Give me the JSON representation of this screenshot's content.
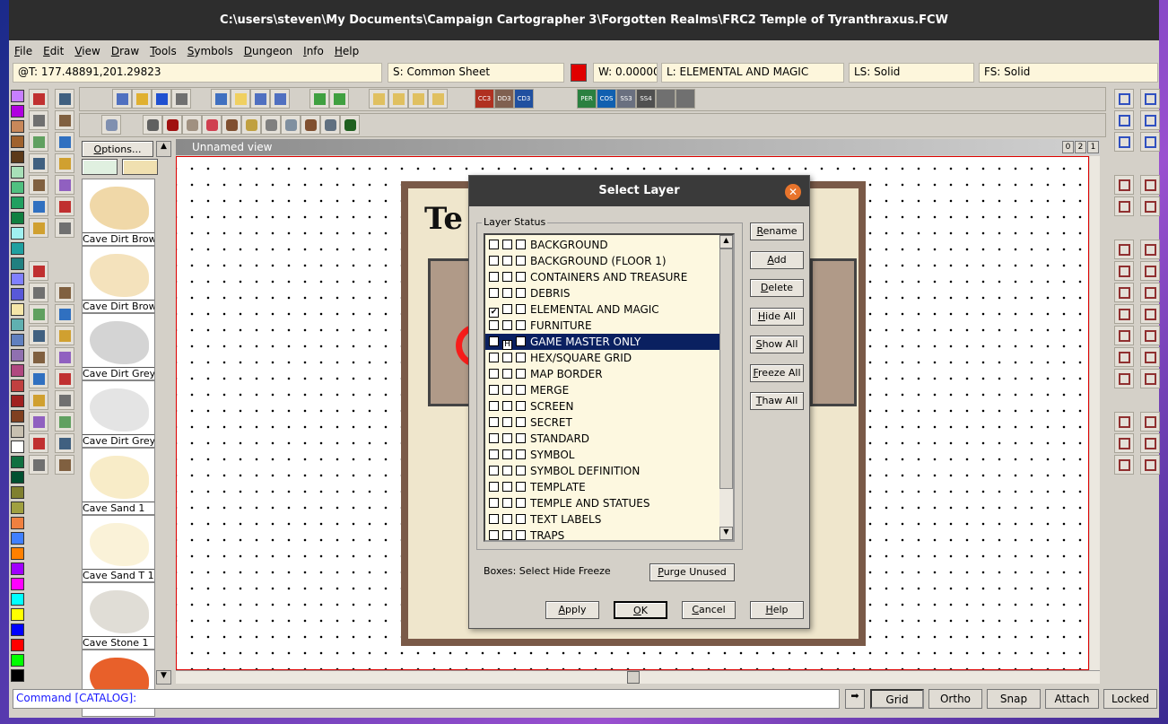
{
  "window": {
    "title": "C:\\users\\steven\\My Documents\\Campaign Cartographer 3\\Forgotten Realms\\FRC2 Temple of Tyranthraxus.FCW"
  },
  "menu": [
    "File",
    "Edit",
    "View",
    "Draw",
    "Tools",
    "Symbols",
    "Dungeon",
    "Info",
    "Help"
  ],
  "status": {
    "coords": "@T: 177.48891,201.29823",
    "sheet": "S: Common Sheet",
    "color": "#e00000",
    "width": "W: 0.00000",
    "layer": "L: ELEMENTAL AND MAGIC",
    "line_style": "LS: Solid",
    "fill_style": "FS: Solid"
  },
  "palette": [
    "#c77fff",
    "#b000e0",
    "#c8885a",
    "#a0622d",
    "#5c3a1a",
    "#a8e0b8",
    "#50c080",
    "#20a060",
    "#108040",
    "#a0f0f0",
    "#20a0a0",
    "#208080",
    "#8080ff",
    "#5858d8",
    "#f6e6a8",
    "#60b0b0",
    "#6080c0",
    "#9070b0",
    "#b04880",
    "#c04040",
    "#a02020",
    "#804020",
    "#c8c0b0",
    "#ffffff",
    "#107040",
    "#005030",
    "#808030",
    "#a0a040",
    "#f08040",
    "#4080ff",
    "#ff8000",
    "#a000ff",
    "#ff00ff",
    "#00ffff",
    "#ffff00",
    "#0000ff",
    "#ff0000",
    "#00ff00",
    "#000000"
  ],
  "toolbar_labels": [
    "CC3",
    "DD3",
    "CD3",
    "PER",
    "COS",
    "SS3",
    "SS4"
  ],
  "catalog": {
    "options_label": "Options...",
    "items": [
      {
        "label": "Cave Dirt Brow",
        "color": "#f0d8a8"
      },
      {
        "label": "Cave Dirt Brow",
        "color": "#f4e2bc"
      },
      {
        "label": "Cave Dirt Grey",
        "color": "#d4d4d4"
      },
      {
        "label": "Cave Dirt Grey",
        "color": "#e4e4e4"
      },
      {
        "label": "Cave Sand 1",
        "color": "#f8ecc8"
      },
      {
        "label": "Cave Sand T 1",
        "color": "#faf2d8"
      },
      {
        "label": "Cave Stone 1",
        "color": "#e0ddd6"
      },
      {
        "label": "",
        "color": "#e8602a"
      }
    ]
  },
  "view": {
    "title": "Unnamed view",
    "buttons": [
      "0",
      "2",
      "1"
    ],
    "map_title": "Te"
  },
  "dialog": {
    "title": "Select Layer",
    "group_label": "Layer Status",
    "layers": [
      {
        "name": "BACKGROUND",
        "s": "",
        "h": "",
        "f": ""
      },
      {
        "name": "BACKGROUND (FLOOR 1)",
        "s": "",
        "h": "",
        "f": ""
      },
      {
        "name": "CONTAINERS AND TREASURE",
        "s": "",
        "h": "",
        "f": ""
      },
      {
        "name": "DEBRIS",
        "s": "",
        "h": "",
        "f": ""
      },
      {
        "name": "ELEMENTAL AND MAGIC",
        "s": "✔",
        "h": "",
        "f": ""
      },
      {
        "name": "FURNITURE",
        "s": "",
        "h": "",
        "f": ""
      },
      {
        "name": "GAME MASTER ONLY",
        "s": "",
        "h": "H",
        "f": "",
        "selected": true
      },
      {
        "name": "HEX/SQUARE GRID",
        "s": "",
        "h": "",
        "f": ""
      },
      {
        "name": "MAP BORDER",
        "s": "",
        "h": "",
        "f": ""
      },
      {
        "name": "MERGE",
        "s": "",
        "h": "",
        "f": ""
      },
      {
        "name": "SCREEN",
        "s": "",
        "h": "",
        "f": ""
      },
      {
        "name": "SECRET",
        "s": "",
        "h": "",
        "f": ""
      },
      {
        "name": "STANDARD",
        "s": "",
        "h": "",
        "f": ""
      },
      {
        "name": "SYMBOL",
        "s": "",
        "h": "",
        "f": ""
      },
      {
        "name": "SYMBOL DEFINITION",
        "s": "",
        "h": "",
        "f": ""
      },
      {
        "name": "TEMPLATE",
        "s": "",
        "h": "",
        "f": ""
      },
      {
        "name": "TEMPLE AND STATUES",
        "s": "",
        "h": "",
        "f": ""
      },
      {
        "name": "TEXT LABELS",
        "s": "",
        "h": "",
        "f": ""
      },
      {
        "name": "TRAPS",
        "s": "",
        "h": "",
        "f": ""
      }
    ],
    "side_buttons": [
      "Rename",
      "Add",
      "Delete",
      "Hide All",
      "Show All",
      "Freeze All",
      "Thaw All"
    ],
    "boxes_hint": "Boxes: Select Hide Freeze",
    "purge": "Purge Unused",
    "footer_buttons": [
      "Apply",
      "OK",
      "Cancel",
      "Help"
    ]
  },
  "command": {
    "prompt": "Command [CATALOG]:"
  },
  "modes": [
    "Grid",
    "Ortho",
    "Snap",
    "Attach",
    "Locked"
  ]
}
